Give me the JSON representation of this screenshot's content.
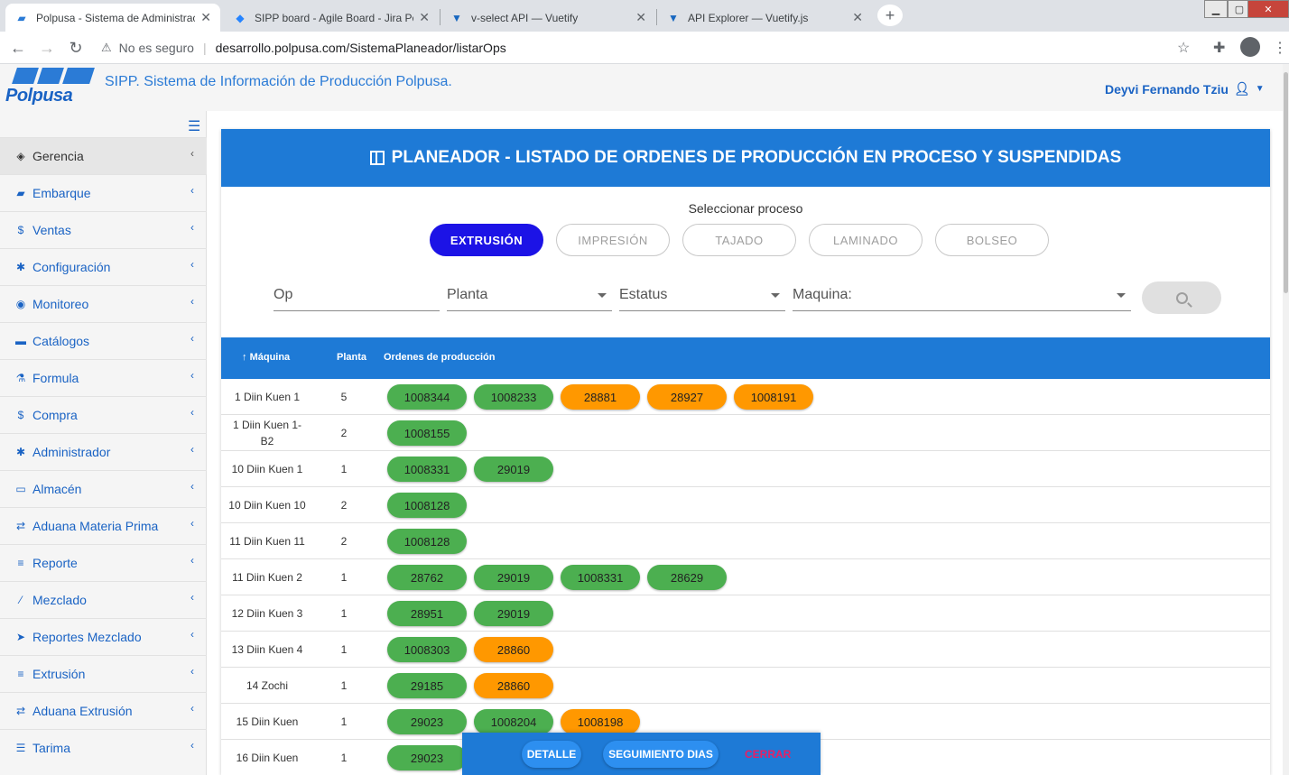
{
  "browser": {
    "tabs": [
      {
        "title": "Polpusa - Sistema de Administrac",
        "active": true,
        "icon": "polpusa-favicon"
      },
      {
        "title": "SIPP board - Agile Board - Jira Pc",
        "active": false,
        "icon": "jira-favicon"
      },
      {
        "title": "v-select API — Vuetify",
        "active": false,
        "icon": "vuetify-favicon"
      },
      {
        "title": "API Explorer — Vuetify.js",
        "active": false,
        "icon": "vuetify-favicon"
      }
    ],
    "new_tab": "+",
    "insecure_label": "No es seguro",
    "url": "desarrollo.polpusa.com/SistemaPlaneador/listarOps"
  },
  "header": {
    "logo_text": "Polpusa",
    "title": "SIPP. Sistema de Información de Producción Polpusa.",
    "user": "Deyvi Fernando Tziu"
  },
  "sidebar": {
    "items": [
      {
        "label": "Gerencia",
        "icon": "cube-icon",
        "glyph": "◈"
      },
      {
        "label": "Embarque",
        "icon": "truck-icon",
        "glyph": "▰"
      },
      {
        "label": "Ventas",
        "icon": "dollar-icon",
        "glyph": "$"
      },
      {
        "label": "Configuración",
        "icon": "gear-icon",
        "glyph": "✱"
      },
      {
        "label": "Monitoreo",
        "icon": "eye-icon",
        "glyph": "◉"
      },
      {
        "label": "Catálogos",
        "icon": "folder-icon",
        "glyph": "▬"
      },
      {
        "label": "Formula",
        "icon": "flask-icon",
        "glyph": "⚗"
      },
      {
        "label": "Compra",
        "icon": "dollar-icon",
        "glyph": "$"
      },
      {
        "label": "Administrador",
        "icon": "gear-icon",
        "glyph": "✱"
      },
      {
        "label": "Almacén",
        "icon": "laptop-icon",
        "glyph": "▭"
      },
      {
        "label": "Aduana Materia Prima",
        "icon": "exchange-icon",
        "glyph": "⇄"
      },
      {
        "label": "Reporte",
        "icon": "database-icon",
        "glyph": "≡"
      },
      {
        "label": "Mezclado",
        "icon": "magic-wand-icon",
        "glyph": "⁄"
      },
      {
        "label": "Reportes Mezclado",
        "icon": "send-icon",
        "glyph": "➤"
      },
      {
        "label": "Extrusión",
        "icon": "database-icon",
        "glyph": "≡"
      },
      {
        "label": "Aduana Extrusión",
        "icon": "exchange-icon",
        "glyph": "⇄"
      },
      {
        "label": "Tarima",
        "icon": "list-icon",
        "glyph": "☰"
      }
    ]
  },
  "main": {
    "title": "PLANEADOR - LISTADO DE ORDENES DE PRODUCCIÓN EN PROCESO Y SUSPENDIDAS",
    "select_label": "Seleccionar proceso",
    "processes": [
      "EXTRUSIÓN",
      "IMPRESIÓN",
      "TAJADO",
      "LAMINADO",
      "BOLSEO"
    ],
    "active_process": "EXTRUSIÓN",
    "filters": {
      "op": "Op",
      "planta": "Planta",
      "estatus": "Estatus",
      "maquina": "Maquina:"
    },
    "table": {
      "headers": {
        "maquina": "Máquina",
        "planta": "Planta",
        "ordenes": "Ordenes de producción"
      },
      "rows": [
        {
          "maquina": "1 Diin Kuen 1",
          "planta": "5",
          "orders": [
            [
              "1008344",
              "green"
            ],
            [
              "1008233",
              "green"
            ],
            [
              "28881",
              "orange"
            ],
            [
              "28927",
              "orange"
            ],
            [
              "1008191",
              "orange"
            ]
          ]
        },
        {
          "maquina": "1 Diin Kuen 1-B2",
          "planta": "2",
          "orders": [
            [
              "1008155",
              "green"
            ]
          ]
        },
        {
          "maquina": "10 Diin Kuen 1",
          "planta": "1",
          "orders": [
            [
              "1008331",
              "green"
            ],
            [
              "29019",
              "green"
            ]
          ]
        },
        {
          "maquina": "10 Diin Kuen 10",
          "planta": "2",
          "orders": [
            [
              "1008128",
              "green"
            ]
          ]
        },
        {
          "maquina": "11 Diin Kuen 11",
          "planta": "2",
          "orders": [
            [
              "1008128",
              "green"
            ]
          ]
        },
        {
          "maquina": "11 Diin Kuen 2",
          "planta": "1",
          "orders": [
            [
              "28762",
              "green"
            ],
            [
              "29019",
              "green"
            ],
            [
              "1008331",
              "green"
            ],
            [
              "28629",
              "green"
            ]
          ]
        },
        {
          "maquina": "12 Diin Kuen 3",
          "planta": "1",
          "orders": [
            [
              "28951",
              "green"
            ],
            [
              "29019",
              "green"
            ]
          ]
        },
        {
          "maquina": "13 Diin Kuen 4",
          "planta": "1",
          "orders": [
            [
              "1008303",
              "green"
            ],
            [
              "28860",
              "orange"
            ]
          ]
        },
        {
          "maquina": "14 Zochi",
          "planta": "1",
          "orders": [
            [
              "29185",
              "green"
            ],
            [
              "28860",
              "orange"
            ]
          ]
        },
        {
          "maquina": "15 Diin Kuen",
          "planta": "1",
          "orders": [
            [
              "29023",
              "green"
            ],
            [
              "1008204",
              "green"
            ],
            [
              "1008198",
              "orange"
            ]
          ]
        },
        {
          "maquina": "16 Diin Kuen",
          "planta": "1",
          "orders": [
            [
              "29023",
              "green"
            ]
          ]
        }
      ]
    }
  },
  "bottom_bar": {
    "detalle": "DETALLE",
    "seguimiento": "SEGUIMIENTO DIAS",
    "cerrar": "CERRAR"
  },
  "colors": {
    "primary": "#1e7ad6",
    "active_process": "#1c13e6",
    "chip_green": "#4caf50",
    "chip_orange": "#ff9800"
  }
}
